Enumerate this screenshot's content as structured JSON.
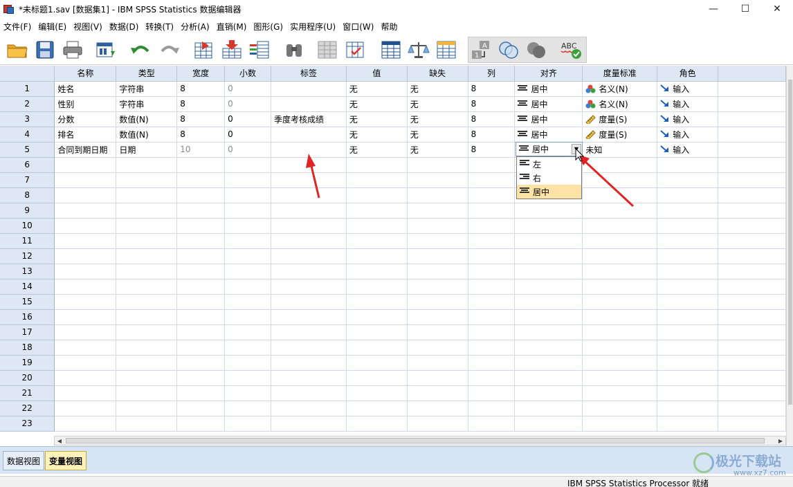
{
  "window": {
    "title": "*未标题1.sav [数据集1] - IBM SPSS Statistics 数据编辑器",
    "minimize": "—",
    "maximize": "☐",
    "close": "✕"
  },
  "menu": [
    "文件(F)",
    "编辑(E)",
    "视图(V)",
    "数据(D)",
    "转换(T)",
    "分析(A)",
    "直销(M)",
    "图形(G)",
    "实用程序(U)",
    "窗口(W)",
    "帮助"
  ],
  "toolbar": {
    "buttons": [
      "open-folder",
      "save",
      "print",
      "recall-dialog",
      "undo",
      "redo",
      "goto-case",
      "goto-variable",
      "variables",
      "find",
      "insert-cases",
      "insert-variable",
      "split-file",
      "weight-cases",
      "select-cases",
      "value-labels",
      "use-sets",
      "show-all-variables",
      "spell-check"
    ],
    "spellcheck_label": "ABC"
  },
  "grid": {
    "columns": [
      "名称",
      "类型",
      "宽度",
      "小数",
      "标签",
      "值",
      "缺失",
      "列",
      "对齐",
      "度量标准",
      "角色"
    ],
    "rows": [
      {
        "num": "1",
        "name": "姓名",
        "type": "字符串",
        "width": "8",
        "decimals": "0",
        "label": "",
        "values": "无",
        "missing": "无",
        "columns": "8",
        "align": "居中",
        "measure": "名义(N)",
        "measure_icon": "nominal-icon",
        "role": "输入"
      },
      {
        "num": "2",
        "name": "性别",
        "type": "字符串",
        "width": "8",
        "decimals": "0",
        "label": "",
        "values": "无",
        "missing": "无",
        "columns": "8",
        "align": "居中",
        "measure": "名义(N)",
        "measure_icon": "nominal-icon",
        "role": "输入"
      },
      {
        "num": "3",
        "name": "分数",
        "type": "数值(N)",
        "width": "8",
        "decimals": "0",
        "label": "季度考核成绩",
        "values": "无",
        "missing": "无",
        "columns": "8",
        "align": "居中",
        "measure": "度量(S)",
        "measure_icon": "scale-icon",
        "role": "输入"
      },
      {
        "num": "4",
        "name": "排名",
        "type": "数值(N)",
        "width": "8",
        "decimals": "0",
        "label": "",
        "values": "无",
        "missing": "无",
        "columns": "8",
        "align": "居中",
        "measure": "度量(S)",
        "measure_icon": "scale-icon",
        "role": "输入"
      },
      {
        "num": "5",
        "name": "合同到期日期",
        "type": "日期",
        "width": "10",
        "decimals": "0",
        "label": "",
        "values": "无",
        "missing": "无",
        "columns": "8",
        "align": "居中",
        "measure": "未知",
        "measure_icon": "",
        "role": "输入"
      }
    ],
    "empty_rows": [
      "6",
      "7",
      "8",
      "9",
      "10",
      "11",
      "12",
      "13",
      "14",
      "15",
      "16",
      "17",
      "18",
      "19",
      "20",
      "21",
      "22",
      "23"
    ]
  },
  "align_dropdown": {
    "current": "居中",
    "options": [
      "左",
      "右",
      "居中"
    ],
    "selected": "居中"
  },
  "tabs": {
    "data_view": "数据视图",
    "variable_view": "变量视图",
    "active": "变量视图"
  },
  "status": "IBM SPSS Statistics Processor 就绪",
  "watermark": {
    "text": "极光下载站",
    "url": "www.xz7.com"
  },
  "colors": {
    "header_bg": "#dde8f4",
    "active_tab": "#fff2b8",
    "selected_option": "#ffe3a6",
    "annotation_arrow": "#e02424"
  }
}
